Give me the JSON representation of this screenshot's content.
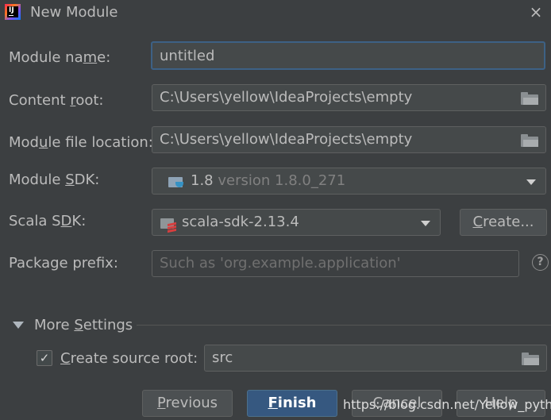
{
  "window": {
    "title": "New Module"
  },
  "form": {
    "module_name": {
      "label_before": "Module na",
      "label_ul": "m",
      "label_after": "e:",
      "value": "untitled"
    },
    "content_root": {
      "label_before": "Content ",
      "label_ul": "r",
      "label_after": "oot:",
      "value": "C:\\Users\\yellow\\IdeaProjects\\empty"
    },
    "module_file_location": {
      "label_before": "Mod",
      "label_ul": "u",
      "label_after": "le file location:",
      "value": "C:\\Users\\yellow\\IdeaProjects\\empty"
    },
    "module_sdk": {
      "label_before": "Module ",
      "label_ul": "S",
      "label_after": "DK:",
      "value": "1.8",
      "detail": "version 1.8.0_271"
    },
    "scala_sdk": {
      "label_before": "Scala S",
      "label_ul": "D",
      "label_after": "K:",
      "value": "scala-sdk-2.13.4",
      "create_ul": "C",
      "create_rest": "reate..."
    },
    "package_prefix": {
      "label": "Package prefix:",
      "placeholder": "Such as 'org.example.application'"
    }
  },
  "more_settings": {
    "label_before": "More ",
    "label_ul": "S",
    "label_after": "ettings",
    "create_source_root": {
      "checked": true,
      "check_mark": "✓",
      "label_ul": "C",
      "label_rest": "reate source root:",
      "value": "src"
    }
  },
  "buttons": {
    "previous": {
      "ul": "P",
      "rest": "revious"
    },
    "finish": {
      "ul": "F",
      "rest": "inish"
    },
    "cancel": "Cancel",
    "help": "Help"
  },
  "help_icon": "?",
  "close_icon": "×",
  "watermark": "https://blog.csdn.net/Yellow_python",
  "colors": {
    "background": "#3c3f41",
    "focus_border": "#3d6185",
    "default_button": "#365880"
  }
}
